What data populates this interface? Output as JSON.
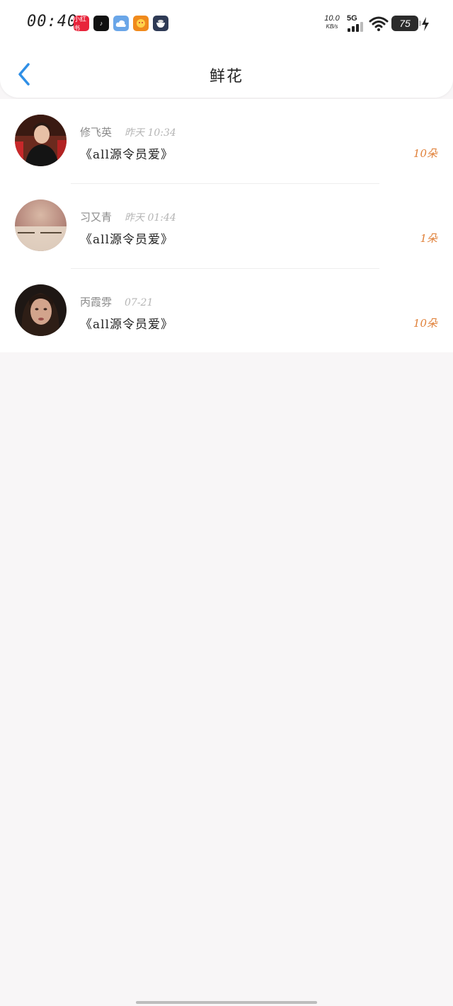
{
  "status_bar": {
    "time": "00:40",
    "app_icons": [
      {
        "name": "xiaohongshu-icon",
        "label": "小红书"
      },
      {
        "name": "tiktok-icon",
        "label": "♪"
      },
      {
        "name": "cloud-icon",
        "label": ""
      },
      {
        "name": "shop-icon",
        "label": ""
      },
      {
        "name": "rice-bowl-icon",
        "label": ""
      }
    ],
    "net_speed_value": "10.0",
    "net_speed_unit": "KB/s",
    "network": "5G",
    "battery": "75"
  },
  "header": {
    "title": "鲜花"
  },
  "items": [
    {
      "user": "修飞英",
      "date": "昨天 10:34",
      "book": "《all源令员爱》",
      "count": "10朵"
    },
    {
      "user": "习又青",
      "date": "昨天 01:44",
      "book": "《all源令员爱》",
      "count": "1朵"
    },
    {
      "user": "丙霞雰",
      "date": "07-21",
      "book": "《all源令员爱》",
      "count": "10朵"
    }
  ],
  "colors": {
    "accent": "#2f8fe6",
    "count": "#e0813a"
  }
}
